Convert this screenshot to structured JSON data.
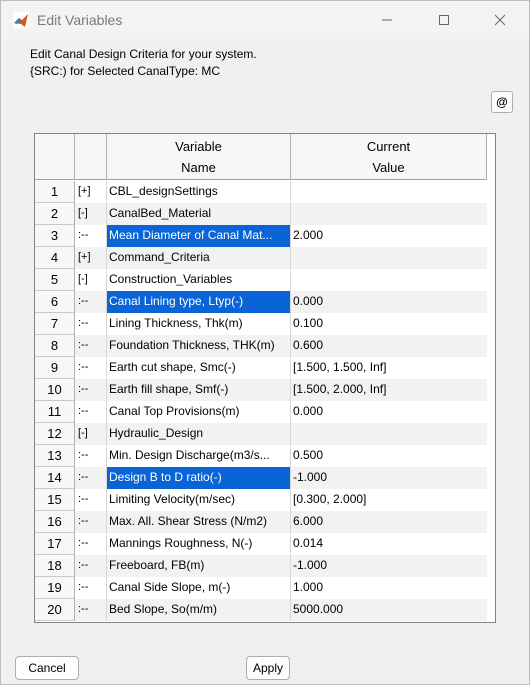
{
  "window": {
    "title": "Edit Variables"
  },
  "description": {
    "line1": "Edit Canal Design Criteria for your system.",
    "line2": "{SRC:) for Selected CanalType: MC"
  },
  "at_button_label": "@",
  "table": {
    "headers": {
      "name_line1": "Variable",
      "name_line2": "Name",
      "value_line1": "Current",
      "value_line2": "Value"
    },
    "rows": [
      {
        "num": "1",
        "tree": "[+]",
        "name": "CBL_designSettings",
        "value": "",
        "selected": false
      },
      {
        "num": "2",
        "tree": "[-]",
        "name": "CanalBed_Material",
        "value": "",
        "selected": false
      },
      {
        "num": "3",
        "tree": ":--",
        "name": "Mean Diameter of Canal Mat...",
        "value": "2.000",
        "selected": true
      },
      {
        "num": "4",
        "tree": "[+]",
        "name": "Command_Criteria",
        "value": "",
        "selected": false
      },
      {
        "num": "5",
        "tree": "[-]",
        "name": "Construction_Variables",
        "value": "",
        "selected": false
      },
      {
        "num": "6",
        "tree": ":--",
        "name": "Canal Lining type, Ltyp(-)",
        "value": "0.000",
        "selected": true
      },
      {
        "num": "7",
        "tree": ":--",
        "name": "Lining Thickness, Thk(m)",
        "value": "0.100",
        "selected": false
      },
      {
        "num": "8",
        "tree": ":--",
        "name": "Foundation Thickness, THK(m)",
        "value": "0.600",
        "selected": false
      },
      {
        "num": "9",
        "tree": ":--",
        "name": "Earth cut shape, Smc(-)",
        "value": "[1.500, 1.500, Inf]",
        "selected": false
      },
      {
        "num": "10",
        "tree": ":--",
        "name": "Earth fill shape, Smf(-)",
        "value": "[1.500, 2.000, Inf]",
        "selected": false
      },
      {
        "num": "11",
        "tree": ":--",
        "name": "Canal Top Provisions(m)",
        "value": "0.000",
        "selected": false
      },
      {
        "num": "12",
        "tree": "[-]",
        "name": "Hydraulic_Design",
        "value": "",
        "selected": false
      },
      {
        "num": "13",
        "tree": ":--",
        "name": "Min. Design Discharge(m3/s...",
        "value": "0.500",
        "selected": false
      },
      {
        "num": "14",
        "tree": ":--",
        "name": "Design B to D ratio(-)",
        "value": "-1.000",
        "selected": true
      },
      {
        "num": "15",
        "tree": ":--",
        "name": "Limiting Velocity(m/sec)",
        "value": "[0.300, 2.000]",
        "selected": false
      },
      {
        "num": "16",
        "tree": ":--",
        "name": "Max. All. Shear Stress (N/m2)",
        "value": "6.000",
        "selected": false
      },
      {
        "num": "17",
        "tree": ":--",
        "name": "Mannings Roughness, N(-)",
        "value": "0.014",
        "selected": false
      },
      {
        "num": "18",
        "tree": ":--",
        "name": "Freeboard, FB(m)",
        "value": "-1.000",
        "selected": false
      },
      {
        "num": "19",
        "tree": ":--",
        "name": "Canal Side Slope, m(-)",
        "value": "1.000",
        "selected": false
      },
      {
        "num": "20",
        "tree": ":--",
        "name": "Bed Slope, So(m/m)",
        "value": "5000.000",
        "selected": false
      }
    ]
  },
  "buttons": {
    "cancel": "Cancel",
    "apply": "Apply"
  },
  "colors": {
    "selection": "#0a64d6",
    "stripe": "#f2f2f2",
    "window_bg": "#f0f0f0"
  }
}
